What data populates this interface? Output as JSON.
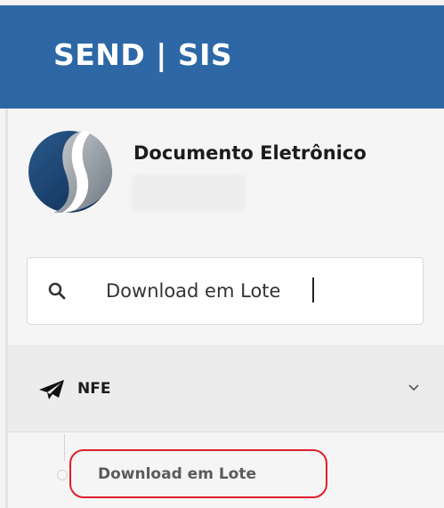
{
  "header": {
    "brand": "SEND | SIS",
    "background_color": "#2d67a6"
  },
  "module": {
    "title": "Documento Eletrônico",
    "logo_icon": "sis-logo-icon"
  },
  "search": {
    "value": "Download em Lote",
    "icon": "search-icon"
  },
  "nav": {
    "group_label": "NFE",
    "group_icon": "paper-plane-icon",
    "expand_icon": "chevron-down-icon",
    "items": [
      {
        "label": "Download em Lote",
        "highlight_color": "#e01f2a"
      }
    ]
  }
}
